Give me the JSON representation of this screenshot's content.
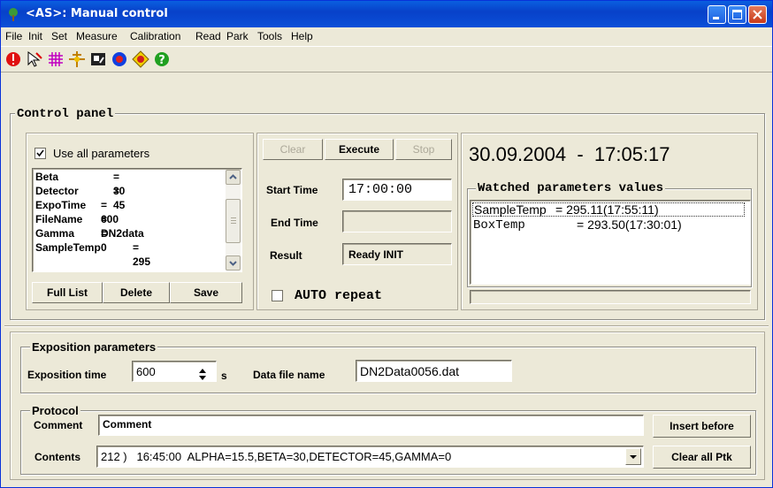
{
  "window": {
    "title": "<AS>: Manual control"
  },
  "menu": [
    "File",
    "Init",
    "Set",
    "Measure",
    "Calibration",
    "Read",
    "Park",
    "Tools",
    "Help"
  ],
  "toolbar": {
    "icons": [
      "stop-icon",
      "cursor-icon",
      "grid-icon",
      "crosshair-icon",
      "photo-icon",
      "record-icon",
      "target-icon",
      "help-icon"
    ]
  },
  "control_panel": {
    "title": "Control panel",
    "use_all_label": "Use all parameters",
    "params": [
      "Beta = 30",
      "Detector = 45",
      "ExpoTime = 600",
      "FileName = DN2data",
      "Gamma = 0",
      "SampleTemp = 295"
    ],
    "params_names": [
      "Beta",
      "Detector",
      "ExpoTime",
      "FileName",
      "Gamma",
      "SampleTemp"
    ],
    "params_values": [
      "= 30",
      "= 45",
      "= 600",
      "= DN2data",
      "= 0",
      "= 295"
    ],
    "buttons": {
      "full_list": "Full List",
      "delete": "Delete",
      "save": "Save"
    },
    "exec_buttons": {
      "clear": "Clear",
      "execute": "Execute",
      "stop": "Stop"
    },
    "start_time_label": "Start Time",
    "start_time_value": "17:00:00",
    "end_time_label": "End Time",
    "end_time_value": "",
    "result_label": "Result",
    "result_value": "Ready INIT",
    "auto_repeat_label": "AUTO repeat",
    "datetime": "30.09.2004  -  17:05:17",
    "watched_title": "Watched parameters values",
    "watched": [
      {
        "name": "SampleTemp",
        "value": "= 295.11(17:55:11)"
      },
      {
        "name": "BoxTemp",
        "value": "= 293.50(17:30:01)"
      }
    ]
  },
  "exposition": {
    "title": "Exposition parameters",
    "time_label": "Exposition time",
    "time_value": "600",
    "unit": "s",
    "file_label": "Data file name",
    "file_value": "DN2Data0056.dat"
  },
  "protocol": {
    "title": "Protocol",
    "comment_label": "Comment",
    "comment_value": "Comment",
    "insert_before": "Insert before",
    "contents_label": "Contents",
    "contents_value": "212 )   16:45:00  ALPHA=15.5,BETA=30,DETECTOR=45,GAMMA=0",
    "clear_all": "Clear all Ptk"
  }
}
